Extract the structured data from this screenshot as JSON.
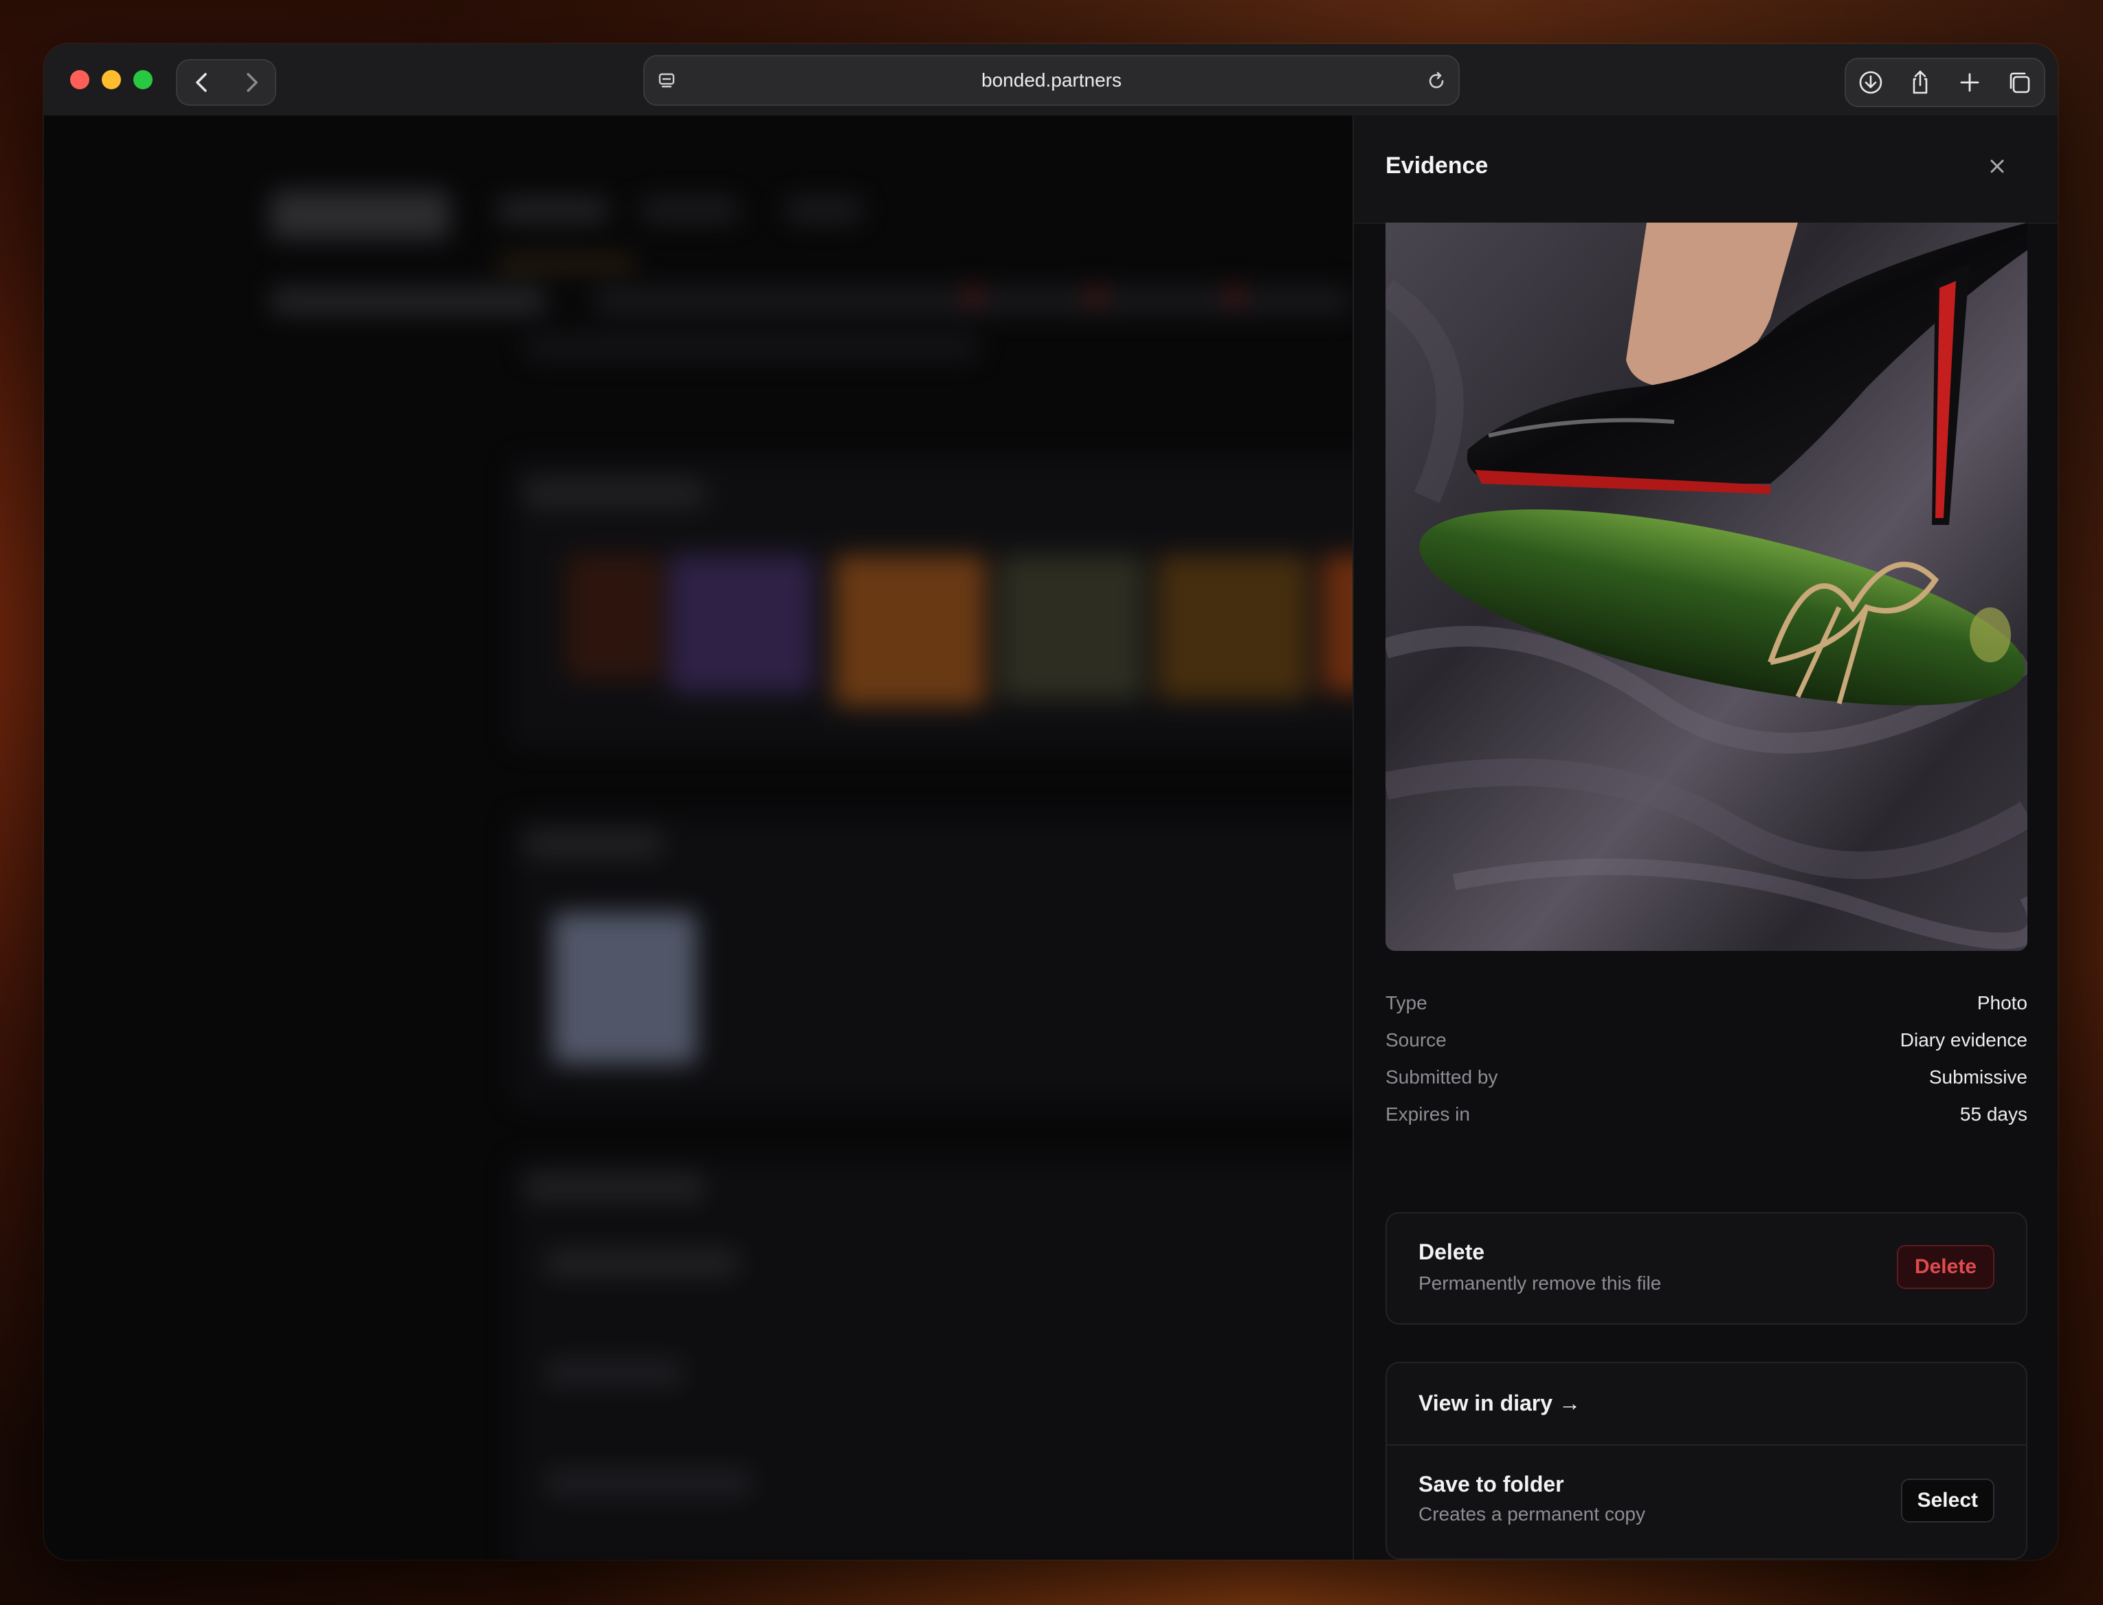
{
  "browser": {
    "url": "bonded.partners",
    "back_icon": "‹",
    "forward_icon": "›",
    "site_icon": "site-settings-icon",
    "reload_icon": "reload-icon",
    "toolbar_icons": [
      "download-icon",
      "share-icon",
      "new-tab-icon",
      "tabs-overview-icon"
    ]
  },
  "drawer": {
    "title": "Evidence",
    "close_icon": "×",
    "photo_alt": "evidence-photo",
    "meta": [
      {
        "key": "Type",
        "value": "Photo"
      },
      {
        "key": "Source",
        "value": "Diary evidence"
      },
      {
        "key": "Submitted by",
        "value": "Submissive"
      },
      {
        "key": "Expires in",
        "value": "55 days"
      }
    ],
    "delete_card": {
      "title": "Delete",
      "subtitle": "Permanently remove this file",
      "button": "Delete"
    },
    "links_card": {
      "view_label": "View in diary →",
      "save_title": "Save to folder",
      "save_subtitle": "Creates a permanent copy",
      "select_button": "Select"
    }
  },
  "colors": {
    "danger": "#e04a4f",
    "panel_bg": "#0e0e10",
    "accent_red": "#d4211e"
  }
}
